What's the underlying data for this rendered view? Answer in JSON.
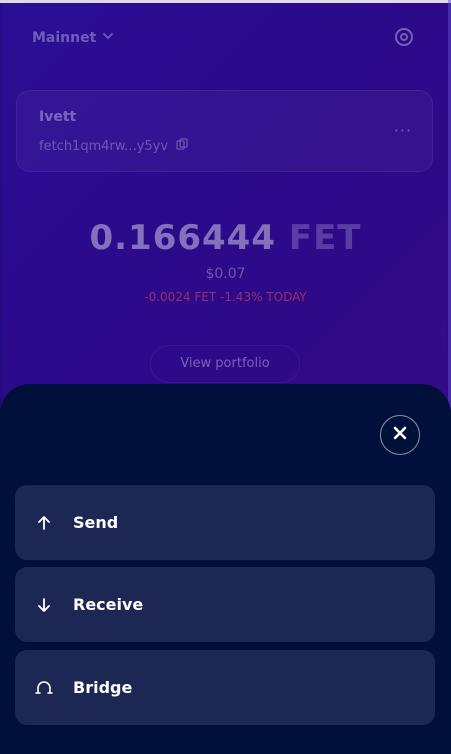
{
  "background": {
    "network_selector": "Mainnet",
    "wallet_name": "Ivett",
    "wallet_address": "fetch1qm4rw...y5yv",
    "balance_amount": "0.166444",
    "balance_unit": "FET",
    "fiat_value": "$0.07",
    "change_text": "-0.0024 FET -1.43% TODAY",
    "view_portfolio_label": "View portfolio"
  },
  "actions": [
    {
      "label": "Send",
      "icon": "arrow-up-icon"
    },
    {
      "label": "Receive",
      "icon": "arrow-down-icon"
    },
    {
      "label": "Bridge",
      "icon": "bridge-icon"
    }
  ],
  "colors": {
    "sheet": "#010f3b",
    "action_bg": "#1c2853",
    "backdrop": "#2a0f96",
    "negative": "#e0455d"
  }
}
